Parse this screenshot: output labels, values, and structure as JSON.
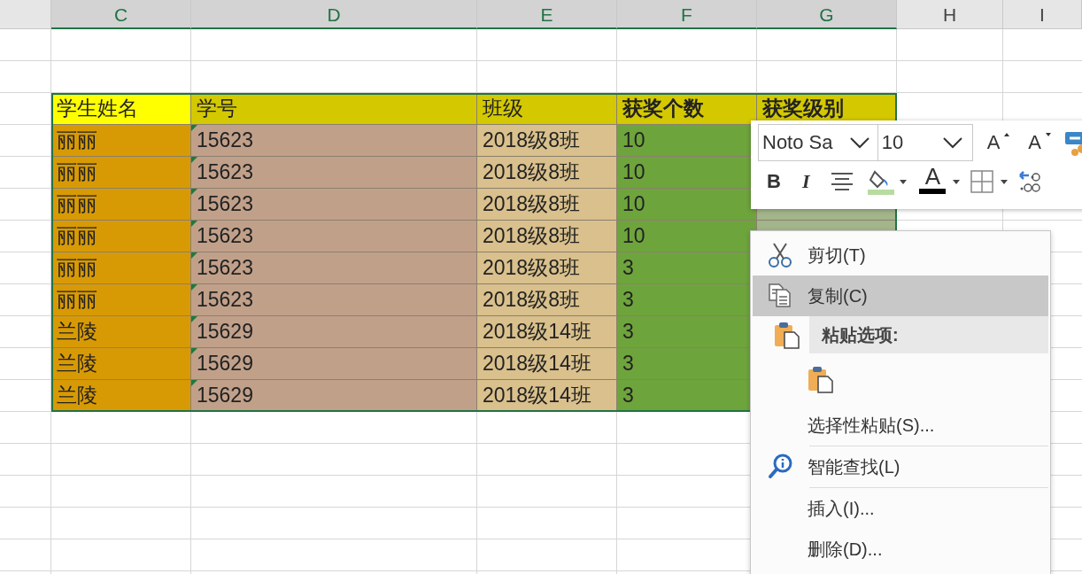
{
  "columns": [
    {
      "label": "C",
      "selected": true
    },
    {
      "label": "D",
      "selected": true
    },
    {
      "label": "E",
      "selected": true
    },
    {
      "label": "F",
      "selected": true
    },
    {
      "label": "G",
      "selected": true
    },
    {
      "label": "H",
      "selected": false
    },
    {
      "label": "I",
      "selected": false
    }
  ],
  "table": {
    "headers": [
      {
        "label": "学生姓名",
        "bold": false
      },
      {
        "label": "学号",
        "bold": false
      },
      {
        "label": "班级",
        "bold": false
      },
      {
        "label": "获奖个数",
        "bold": true
      },
      {
        "label": "获奖级别",
        "bold": true
      }
    ],
    "rows": [
      {
        "cells": [
          "丽丽",
          "15623",
          "2018级8班",
          "10"
        ],
        "text_number": true
      },
      {
        "cells": [
          "丽丽",
          "15623",
          "2018级8班",
          "10"
        ],
        "text_number": true
      },
      {
        "cells": [
          "丽丽",
          "15623",
          "2018级8班",
          "10"
        ],
        "text_number": true
      },
      {
        "cells": [
          "丽丽",
          "15623",
          "2018级8班",
          "10"
        ],
        "text_number": true
      },
      {
        "cells": [
          "丽丽",
          "15623",
          "2018级8班",
          "3"
        ],
        "text_number": true
      },
      {
        "cells": [
          "丽丽",
          "15623",
          "2018级8班",
          "3"
        ],
        "text_number": true
      },
      {
        "cells": [
          "兰陵",
          "15629",
          "2018级14班",
          "3"
        ],
        "text_number": true
      },
      {
        "cells": [
          "兰陵",
          "15629",
          "2018级14班",
          "3"
        ],
        "text_number": true
      },
      {
        "cells": [
          "兰陵",
          "15629",
          "2018级14班",
          "3"
        ],
        "text_number": true
      }
    ]
  },
  "mini_toolbar": {
    "font": "Noto Sa",
    "size": "10",
    "buttons": [
      {
        "kind": "grow",
        "label": "A"
      },
      {
        "kind": "shrink",
        "label": "A"
      },
      {
        "kind": "painter"
      }
    ],
    "format_buttons": [
      {
        "kind": "bold",
        "label": "B"
      },
      {
        "kind": "italic",
        "label": "I"
      },
      {
        "kind": "align"
      },
      {
        "kind": "fill"
      },
      {
        "kind": "fontcolor",
        "label": "A"
      },
      {
        "kind": "borders"
      },
      {
        "kind": "decimal"
      }
    ]
  },
  "context_menu": [
    {
      "kind": "cut",
      "label": "剪切(T)",
      "selected": false
    },
    {
      "kind": "copy",
      "label": "复制(C)",
      "selected": true
    },
    {
      "kind": "heading",
      "label": "粘贴选项:"
    },
    {
      "kind": "paste-options"
    },
    {
      "kind": "command",
      "label": "选择性粘贴(S)...",
      "selected": false
    },
    {
      "kind": "separator"
    },
    {
      "kind": "lookup",
      "label": "智能查找(L)",
      "selected": false
    },
    {
      "kind": "separator"
    },
    {
      "kind": "command",
      "label": "插入(I)...",
      "selected": false
    },
    {
      "kind": "command",
      "label": "删除(D)...",
      "selected": false
    }
  ]
}
